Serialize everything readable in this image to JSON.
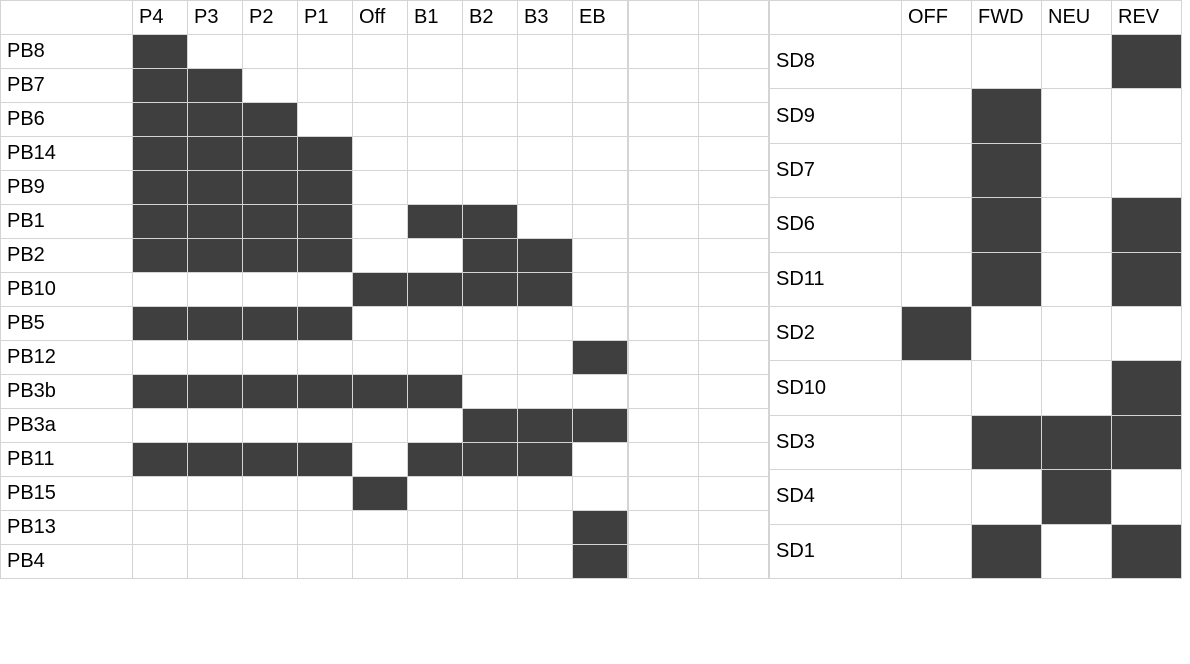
{
  "chart_data": [
    {
      "type": "heatmap",
      "title": "",
      "xlabel": "",
      "ylabel": "",
      "x": [
        "P4",
        "P3",
        "P2",
        "P1",
        "Off",
        "B1",
        "B2",
        "B3",
        "EB"
      ],
      "y": [
        "PB8",
        "PB7",
        "PB6",
        "PB14",
        "PB9",
        "PB1",
        "PB2",
        "PB10",
        "PB5",
        "PB12",
        "PB3b",
        "PB3a",
        "PB11",
        "PB15",
        "PB13",
        "PB4"
      ],
      "z": [
        [
          1,
          0,
          0,
          0,
          0,
          0,
          0,
          0,
          0
        ],
        [
          1,
          1,
          0,
          0,
          0,
          0,
          0,
          0,
          0
        ],
        [
          1,
          1,
          1,
          0,
          0,
          0,
          0,
          0,
          0
        ],
        [
          1,
          1,
          1,
          1,
          0,
          0,
          0,
          0,
          0
        ],
        [
          1,
          1,
          1,
          1,
          0,
          0,
          0,
          0,
          0
        ],
        [
          1,
          1,
          1,
          1,
          0,
          1,
          1,
          0,
          0
        ],
        [
          1,
          1,
          1,
          1,
          0,
          0,
          1,
          1,
          0
        ],
        [
          0,
          0,
          0,
          0,
          1,
          1,
          1,
          1,
          0
        ],
        [
          1,
          1,
          1,
          1,
          0,
          0,
          0,
          0,
          0
        ],
        [
          0,
          0,
          0,
          0,
          0,
          0,
          0,
          0,
          1
        ],
        [
          1,
          1,
          1,
          1,
          1,
          1,
          0,
          0,
          0
        ],
        [
          0,
          0,
          0,
          0,
          0,
          0,
          1,
          1,
          1
        ],
        [
          1,
          1,
          1,
          1,
          0,
          1,
          1,
          1,
          0
        ],
        [
          0,
          0,
          0,
          0,
          1,
          0,
          0,
          0,
          0
        ],
        [
          0,
          0,
          0,
          0,
          0,
          0,
          0,
          0,
          1
        ],
        [
          0,
          0,
          0,
          0,
          0,
          0,
          0,
          0,
          1
        ]
      ]
    },
    {
      "type": "heatmap",
      "title": "",
      "xlabel": "",
      "ylabel": "",
      "x": [
        "OFF",
        "FWD",
        "NEU",
        "REV"
      ],
      "y": [
        "SD8",
        "SD9",
        "SD7",
        "SD6",
        "SD11",
        "SD2",
        "SD10",
        "SD3",
        "SD4",
        "SD1"
      ],
      "z": [
        [
          0,
          0,
          0,
          1
        ],
        [
          0,
          1,
          0,
          0
        ],
        [
          0,
          1,
          0,
          0
        ],
        [
          0,
          1,
          0,
          1
        ],
        [
          0,
          1,
          0,
          1
        ],
        [
          1,
          0,
          0,
          0
        ],
        [
          0,
          0,
          0,
          1
        ],
        [
          0,
          1,
          1,
          1
        ],
        [
          0,
          0,
          1,
          0
        ],
        [
          0,
          1,
          0,
          1
        ]
      ]
    }
  ]
}
